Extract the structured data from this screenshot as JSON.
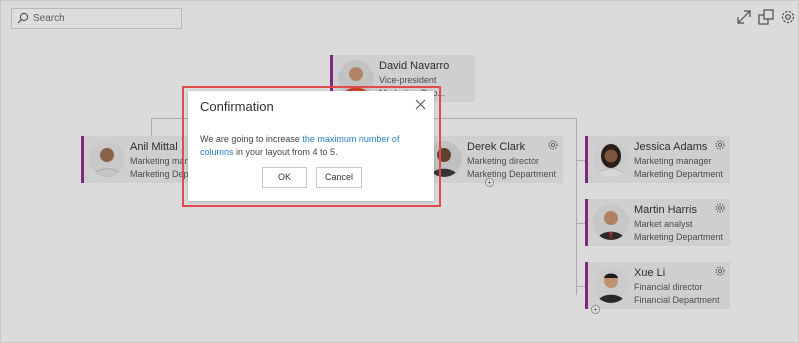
{
  "toolbar": {
    "search_placeholder": "Search",
    "icons": [
      "search-icon",
      "expand-icon",
      "windows-icon",
      "settings-icon"
    ]
  },
  "org": {
    "root": {
      "name": "David Navarro",
      "title": "Vice-president",
      "department": "Marketing Dep..."
    },
    "nodes": [
      {
        "name": "Anil Mittal",
        "title": "Marketing manager",
        "department": "Marketing Department"
      },
      {
        "name": "Derek Clark",
        "title": "Marketing director",
        "department": "Marketing Department"
      },
      {
        "name": "Jessica Adams",
        "title": "Marketing manager",
        "department": "Marketing Department"
      },
      {
        "name": "Martin Harris",
        "title": "Market analyst",
        "department": "Marketing Department"
      },
      {
        "name": "Xue Li",
        "title": "Financial director",
        "department": "Financial Department"
      }
    ],
    "expand_symbol": "+"
  },
  "dialog": {
    "title": "Confirmation",
    "message_before": "We are going to increase ",
    "message_link": "the maximum number of columns",
    "message_after": " in your layout from 4 to 5.",
    "ok_label": "OK",
    "cancel_label": "Cancel"
  },
  "colors": {
    "accent": "#8a2f8e",
    "link": "#2a7ec1",
    "highlight": "#e04a4a"
  }
}
